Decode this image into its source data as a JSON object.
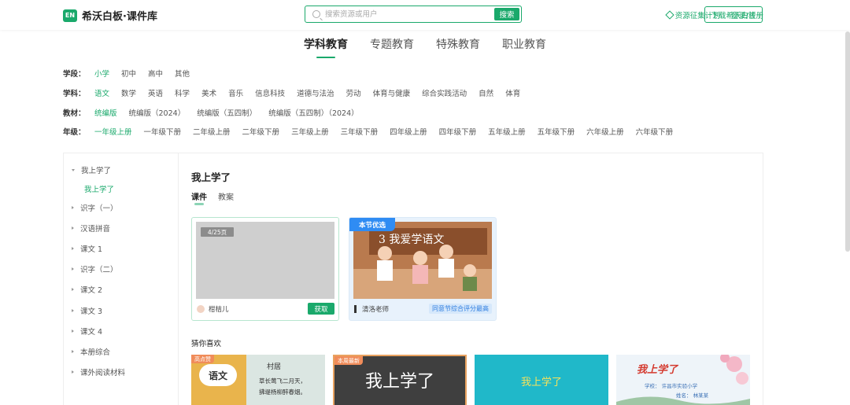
{
  "header": {
    "logo_badge": "EN",
    "logo_text": "希沃白板·课件库",
    "search_placeholder": "搜索资源或用户",
    "search_button": "搜索",
    "links": [
      "资源征集计划",
      "登录/注册"
    ],
    "download_button": "下载希沃白板"
  },
  "main_tabs": [
    {
      "label": "学科教育",
      "active": true
    },
    {
      "label": "专题教育",
      "active": false
    },
    {
      "label": "特殊教育",
      "active": false
    },
    {
      "label": "职业教育",
      "active": false
    }
  ],
  "filters": {
    "stage": {
      "label": "学段：",
      "options": [
        "小学",
        "初中",
        "高中",
        "其他"
      ],
      "active": 0
    },
    "subject": {
      "label": "学科：",
      "options": [
        "语文",
        "数学",
        "英语",
        "科学",
        "美术",
        "音乐",
        "信息科技",
        "道德与法治",
        "劳动",
        "体育与健康",
        "综合实践活动",
        "自然",
        "体育"
      ],
      "active": 0
    },
    "textbook": {
      "label": "教材：",
      "options": [
        "统编版",
        "统编版（2024）",
        "统编版（五四制）",
        "统编版（五四制）（2024）"
      ],
      "active": 0
    },
    "grade": {
      "label": "年级：",
      "options": [
        "一年级上册",
        "一年级下册",
        "二年级上册",
        "二年级下册",
        "三年级上册",
        "三年级下册",
        "四年级上册",
        "四年级下册",
        "五年级上册",
        "五年级下册",
        "六年级上册",
        "六年级下册"
      ],
      "active": 0
    }
  },
  "sidebar": {
    "open_item": "我上学了",
    "open_sub": "我上学了",
    "items": [
      "识字（一）",
      "汉语拼音",
      "课文 1",
      "识字（二）",
      "课文 2",
      "课文 3",
      "课文 4",
      "本册综合",
      "课外阅读材料"
    ]
  },
  "content": {
    "title": "我上学了",
    "sub_tabs": [
      "课件",
      "教案"
    ],
    "cards": [
      {
        "page_badge": "4/25页",
        "author": "柑桔儿",
        "action": "获取"
      },
      {
        "tag": "本节优选",
        "thumb_text": "3 我爱学语文",
        "author": "清洛老师",
        "note": "同意节综合评分最高"
      }
    ],
    "guess_title": "猜你喜欢",
    "recommendations": [
      {
        "tag": "高点赞",
        "thumb_text_a": "语文",
        "thumb_text_b": "村居",
        "line1": "草长莺飞二月天，",
        "line2": "拂堤杨柳醉春烟。"
      },
      {
        "tag": "本周最新",
        "thumb_text": "我上学了"
      },
      {
        "thumb_text": "我上学了"
      },
      {
        "thumb_text": "我上学了",
        "sub_text": "学校： 许昌市实验小学",
        "sub_text2": "姓名： 林某某"
      }
    ]
  }
}
